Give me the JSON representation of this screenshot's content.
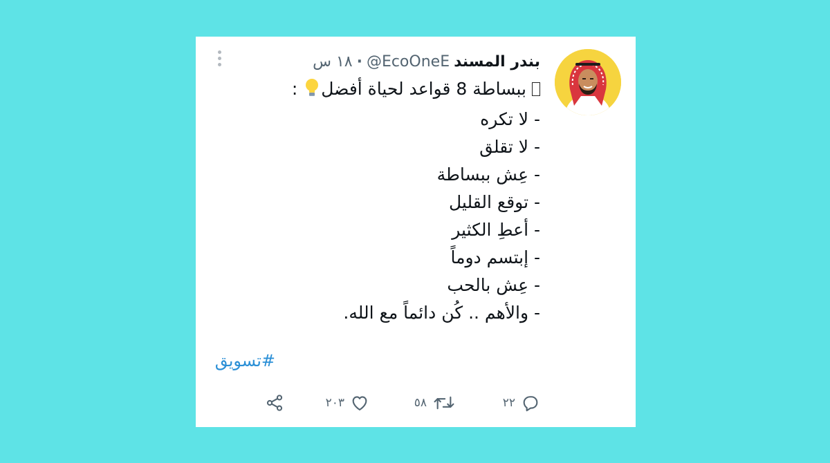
{
  "tweet": {
    "display_name": "بندر المسند",
    "handle": "@EcoOneE",
    "separator": "·",
    "time": "١٨ س",
    "body_lines": [
      "ببساطة 8 قواعد لحياة أفضل",
      "- لا تكره",
      "- لا تقلق",
      "- عِش ببساطة",
      "- توقع القليل",
      "- أعطِ الكثير",
      "- إبتسم دوماً",
      "- عِش بالحب",
      "- والأهم .. كُن دائماً مع الله."
    ],
    "first_line_suffix": ":",
    "hashtag": "#تسويق",
    "reply_count": "٢٢",
    "retweet_count": "٥٨",
    "like_count": "٢٠٣"
  },
  "icons": {
    "more": "more-vertical-icon",
    "bulb": "light-bulb-emoji",
    "reply": "reply-icon",
    "retweet": "retweet-icon",
    "like": "heart-icon",
    "share": "share-icon"
  },
  "colors": {
    "background": "#5ee3e6",
    "card": "#ffffff",
    "hashtag": "#2a8fd6",
    "muted": "#536471",
    "avatar_bg": "#f6d43f"
  }
}
